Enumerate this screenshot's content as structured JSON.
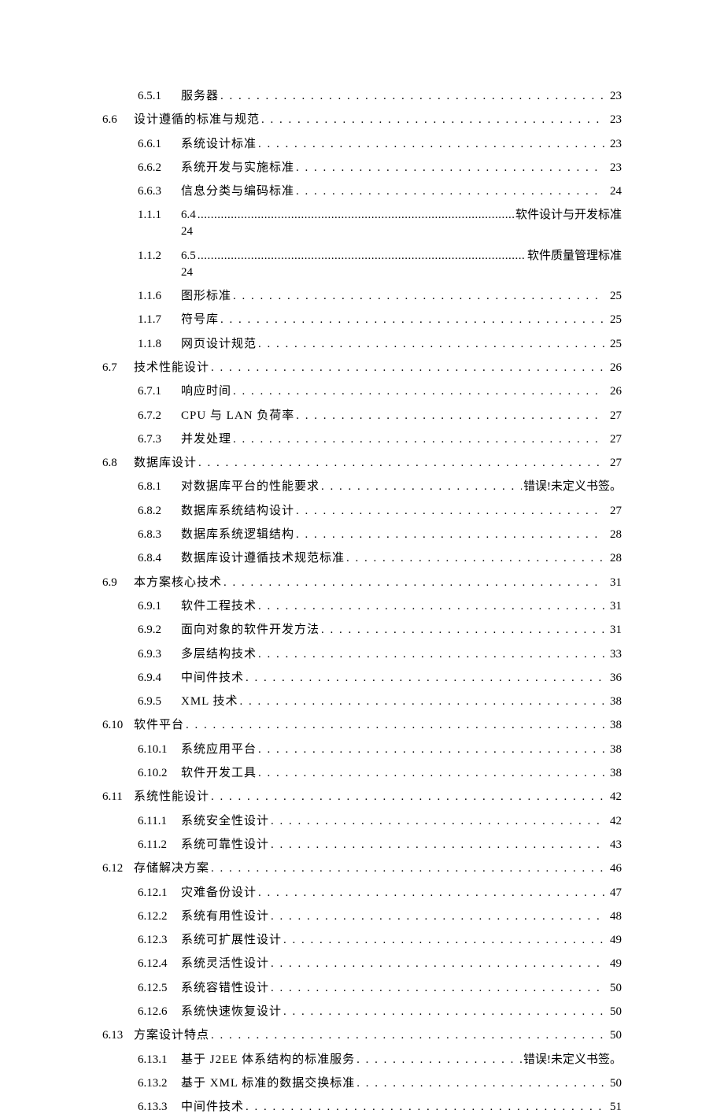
{
  "toc": [
    {
      "lvl": 2,
      "num": "6.5.1",
      "title": "服务器",
      "page": "23"
    },
    {
      "lvl": 1,
      "num": "6.6",
      "title": "设计遵循的标准与规范",
      "page": "23"
    },
    {
      "lvl": 2,
      "num": "6.6.1",
      "title": "系统设计标准",
      "page": "23"
    },
    {
      "lvl": 2,
      "num": "6.6.2",
      "title": "系统开发与实施标准",
      "page": "23"
    },
    {
      "lvl": 2,
      "num": "6.6.3",
      "title": "信息分类与编码标准",
      "page": "24"
    },
    {
      "lvl": 3,
      "num": "1.1.1",
      "pre": "6.4",
      "suffix": "软件设计与开发标准",
      "page": "24"
    },
    {
      "lvl": 3,
      "num": "1.1.2",
      "pre": "6.5",
      "suffix": "软件质量管理标准",
      "page": "24"
    },
    {
      "lvl": 2,
      "num": "1.1.6",
      "title": "图形标准",
      "page": "25"
    },
    {
      "lvl": 2,
      "num": "1.1.7",
      "title": "符号库",
      "page": "25"
    },
    {
      "lvl": 2,
      "num": "1.1.8",
      "title": "网页设计规范",
      "page": "25"
    },
    {
      "lvl": 1,
      "num": "6.7",
      "title": "技术性能设计",
      "page": "26"
    },
    {
      "lvl": 2,
      "num": "6.7.1",
      "title": "响应时间",
      "page": "26"
    },
    {
      "lvl": 2,
      "num": "6.7.2",
      "title": "CPU 与 LAN 负荷率",
      "page": "27"
    },
    {
      "lvl": 2,
      "num": "6.7.3",
      "title": "并发处理",
      "page": "27"
    },
    {
      "lvl": 1,
      "num": "6.8",
      "title": "数据库设计",
      "page": "27"
    },
    {
      "lvl": 2,
      "num": "6.8.1",
      "title": "对数据库平台的性能要求",
      "page": "错误!未定义书签。"
    },
    {
      "lvl": 2,
      "num": "6.8.2",
      "title": "数据库系统结构设计",
      "page": "27"
    },
    {
      "lvl": 2,
      "num": "6.8.3",
      "title": "数据库系统逻辑结构",
      "page": "28"
    },
    {
      "lvl": 2,
      "num": "6.8.4",
      "title": "数据库设计遵循技术规范标准",
      "page": "28"
    },
    {
      "lvl": 1,
      "num": "6.9",
      "title": "本方案核心技术",
      "page": "31"
    },
    {
      "lvl": 2,
      "num": "6.9.1",
      "title": "软件工程技术",
      "page": "31"
    },
    {
      "lvl": 2,
      "num": "6.9.2",
      "title": "面向对象的软件开发方法",
      "page": "31"
    },
    {
      "lvl": 2,
      "num": "6.9.3",
      "title": "多层结构技术",
      "page": "33"
    },
    {
      "lvl": 2,
      "num": "6.9.4",
      "title": "中间件技术",
      "page": "36"
    },
    {
      "lvl": 2,
      "num": "6.9.5",
      "title": "XML 技术",
      "page": "38"
    },
    {
      "lvl": 1,
      "num": "6.10",
      "title": "软件平台",
      "page": "38"
    },
    {
      "lvl": 2,
      "num": "6.10.1",
      "title": "系统应用平台",
      "page": "38"
    },
    {
      "lvl": 2,
      "num": "6.10.2",
      "title": "软件开发工具",
      "page": "38"
    },
    {
      "lvl": 1,
      "num": "6.11",
      "title": "系统性能设计",
      "page": "42"
    },
    {
      "lvl": 2,
      "num": "6.11.1",
      "title": "系统安全性设计",
      "page": "42"
    },
    {
      "lvl": 2,
      "num": "6.11.2",
      "title": "系统可靠性设计",
      "page": "43"
    },
    {
      "lvl": 1,
      "num": "6.12",
      "title": "存储解决方案",
      "page": "46"
    },
    {
      "lvl": 2,
      "num": "6.12.1",
      "title": "灾难备份设计",
      "page": "47"
    },
    {
      "lvl": 2,
      "num": "6.12.2",
      "title": "系统有用性设计",
      "page": "48"
    },
    {
      "lvl": 2,
      "num": "6.12.3",
      "title": "系统可扩展性设计",
      "page": "49"
    },
    {
      "lvl": 2,
      "num": "6.12.4",
      "title": "系统灵活性设计",
      "page": "49"
    },
    {
      "lvl": 2,
      "num": "6.12.5",
      "title": "系统容错性设计",
      "page": "50"
    },
    {
      "lvl": 2,
      "num": "6.12.6",
      "title": "系统快速恢复设计",
      "page": "50"
    },
    {
      "lvl": 1,
      "num": "6.13",
      "title": "方案设计特点",
      "page": "50"
    },
    {
      "lvl": 2,
      "num": "6.13.1",
      "title": "基于 J2EE 体系结构的标准服务",
      "page": "错误!未定义书签。"
    },
    {
      "lvl": 2,
      "num": "6.13.2",
      "title": "基于 XML 标准的数据交换标准",
      "page": "50"
    },
    {
      "lvl": 2,
      "num": "6.13.3",
      "title": "中间件技术",
      "page": "51"
    }
  ]
}
